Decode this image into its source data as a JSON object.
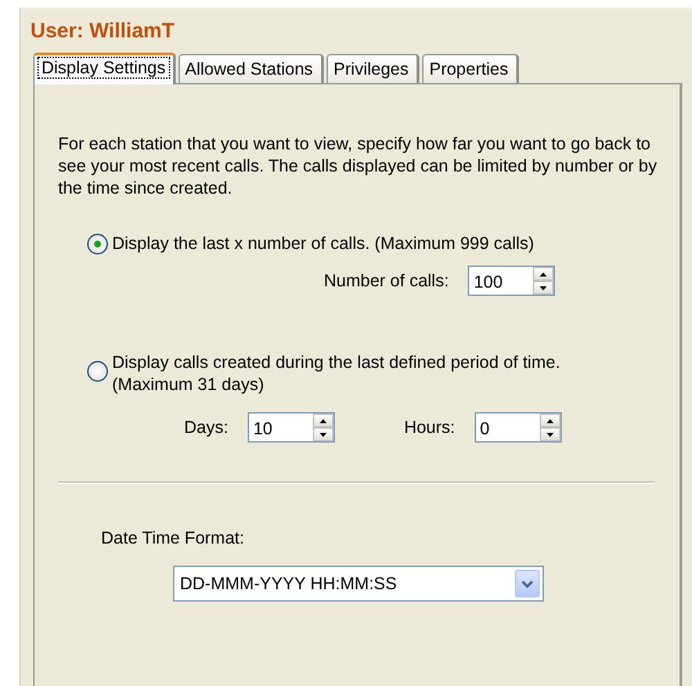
{
  "title": "User: WilliamT",
  "tabs": [
    {
      "label": "Display Settings",
      "selected": true
    },
    {
      "label": "Allowed Stations",
      "selected": false
    },
    {
      "label": "Privileges",
      "selected": false
    },
    {
      "label": "Properties",
      "selected": false
    }
  ],
  "description": "For each station that you want to view, specify how far you want to go back to see your most recent calls. The calls displayed can be limited by number or by the time since created.",
  "options": [
    {
      "label": "Display the last x number of calls. (Maximum 999 calls)",
      "selected": true,
      "fields": [
        {
          "label": "Number of calls:",
          "value": "100"
        }
      ]
    },
    {
      "label": "Display calls created during the last defined period of time. (Maximum 31 days)",
      "selected": false,
      "fields": [
        {
          "label": "Days:",
          "value": "10"
        },
        {
          "label": "Hours:",
          "value": "0"
        }
      ]
    }
  ],
  "date_time_format": {
    "label": "Date Time Format:",
    "value": "DD-MMM-YYYY HH:MM:SS"
  }
}
